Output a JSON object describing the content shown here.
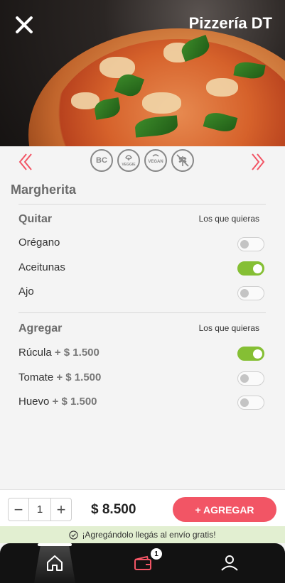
{
  "header": {
    "title": "Pizzería DT"
  },
  "badges": [
    "BC",
    "VEGGIE",
    "VEGAN",
    "gluten-free-icon"
  ],
  "product": {
    "name": "Margherita"
  },
  "remove_section": {
    "title": "Quitar",
    "hint": "Los que quieras",
    "options": [
      {
        "label": "Orégano",
        "on": false
      },
      {
        "label": "Aceitunas",
        "on": true
      },
      {
        "label": "Ajo",
        "on": false
      }
    ]
  },
  "add_section": {
    "title": "Agregar",
    "hint": "Los que quieras",
    "options": [
      {
        "label": "Rúcula",
        "price": "+ $ 1.500",
        "on": true
      },
      {
        "label": "Tomate",
        "price": "+ $ 1.500",
        "on": false
      },
      {
        "label": "Huevo",
        "price": "+ $ 1.500",
        "on": false
      }
    ]
  },
  "order": {
    "minus": "−",
    "plus": "+",
    "quantity": "1",
    "total": "$ 8.500",
    "add_label": "+ AGREGAR"
  },
  "promo": {
    "text": "¡Agregándolo llegás al envío gratis!"
  },
  "nav": {
    "cart_count": "1",
    "items": [
      "home-icon",
      "cart-icon",
      "profile-icon"
    ]
  },
  "colors": {
    "accent": "#f25565",
    "toggle_on": "#85bf34",
    "promo_bg": "#e2efd1",
    "nav_bg": "#121212"
  }
}
